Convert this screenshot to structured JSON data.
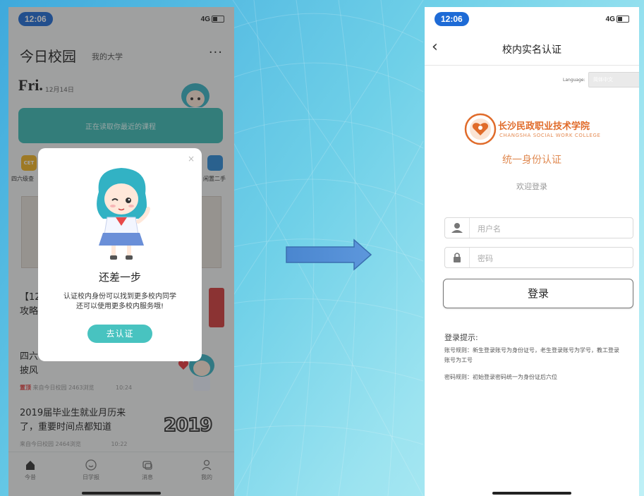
{
  "left_phone": {
    "status": {
      "time": "12:06",
      "network": "4G"
    },
    "header": {
      "title": "今日校园",
      "subtitle": "我的大学",
      "more": "···"
    },
    "date": {
      "day": "Fri.",
      "date_text": "12月14日"
    },
    "banner": {
      "text": "正在读取你最近的课程"
    },
    "icons": [
      {
        "label": "四六级查",
        "badge": "CET",
        "color": "#f2b324"
      },
      {
        "label": "闲置二手",
        "color": "#2b8ad8"
      }
    ],
    "news": [
      {
        "title_line1": "【12",
        "title_line2": "攻略"
      },
      {
        "title_line1": "四六",
        "title_line2": "披风",
        "badge": "置顶",
        "meta": "来自今日校园 2463浏览",
        "time": "10:24"
      },
      {
        "title_line1": "2019届毕业生就业月历来",
        "title_line2": "了，重要时间点都知道",
        "meta": "来自今日校园 2464浏览",
        "time": "10:22",
        "image_text": "2019"
      }
    ],
    "tabs": [
      {
        "label": "今昔",
        "icon": "home-icon",
        "active": true
      },
      {
        "label": "日学报",
        "icon": "smile-icon",
        "active": false
      },
      {
        "label": "消息",
        "icon": "chat-icon",
        "active": false
      },
      {
        "label": "我的",
        "icon": "profile-icon",
        "active": false
      }
    ],
    "modal": {
      "close": "×",
      "title": "还差一步",
      "desc_line1": "认证校内身份可以找到更多校内同学",
      "desc_line2": "还可以使用更多校内服务哦!",
      "button": "去认证"
    }
  },
  "right_phone": {
    "status": {
      "time": "12:06",
      "network": "4G"
    },
    "nav": {
      "back": "‹",
      "title": "校内实名认证"
    },
    "language": {
      "label": "Language:",
      "value": "简体中文"
    },
    "college": {
      "name_cn": "长沙民政职业技术学院",
      "name_en": "CHANGSHA SOCIAL WORK COLLEGE"
    },
    "system_title": "统一身份认证",
    "welcome": "欢迎登录",
    "username": {
      "placeholder": "用户名",
      "value": ""
    },
    "password": {
      "placeholder": "密码",
      "value": ""
    },
    "login_button": "登录",
    "tips": {
      "title": "登录提示:",
      "account_rule": "账号规则：新生登录账号为身份证号，老生登录账号为学号，教工登录账号为工号",
      "password_rule": "密码规则：初始登录密码统一为身份证后六位"
    }
  },
  "colors": {
    "accent_teal": "#48c3c0",
    "brand_orange": "#e06b2a",
    "pill_blue": "#1e6bd6",
    "arrow_blue": "#4a86cf"
  }
}
